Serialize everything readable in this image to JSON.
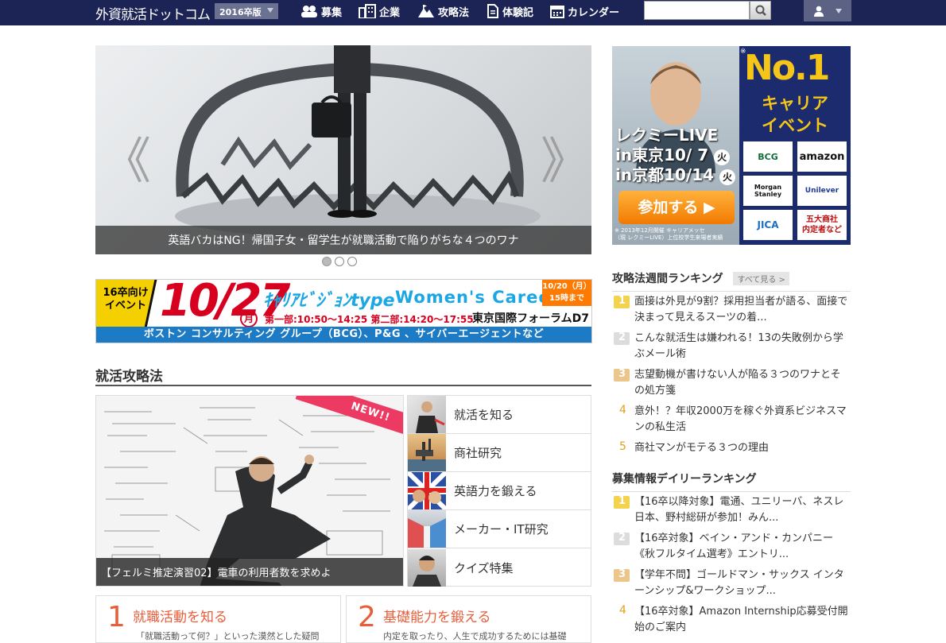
{
  "nav": {
    "logo": "外資就活ドットコム",
    "year": "2016卒版",
    "items": [
      "募集",
      "企業",
      "攻略法",
      "体験記",
      "カレンダー"
    ],
    "search_placeholder": ""
  },
  "hero": {
    "caption": "英語バカはNG！帰国子女・留学生が就職活動で陥りがちな４つのワナ",
    "prev": "《",
    "next": "》",
    "slides_total": 3,
    "slide_active": 1
  },
  "banner": {
    "tag": "16卒向け\nイベント",
    "date": "10/27",
    "weekday": "月",
    "career_vision": "ｷｬﾘｱﾋﾞｼﾞｮﾝtype",
    "womens": "Women's Career",
    "deadline": "10/20（月）\n15時まで",
    "times": "第一部:10:50〜14:25  第二部:14:20〜17:55",
    "venue": "東京国際フォーラムD7",
    "companies": "ボストン コンサルティング グループ（BCG）、P&G 、サイバーエージェントなど"
  },
  "section": {
    "title": "就活攻略法"
  },
  "feature": {
    "new_tag": "NEW!!",
    "caption": "【フェルミ推定演習02】電車の利用者数を求めよ"
  },
  "menu": {
    "items": [
      "就活を知る",
      "商社研究",
      "英語力を鍛える",
      "メーカー・IT研究",
      "クイズ特集"
    ]
  },
  "boxes": [
    {
      "num": "1",
      "title": "就職活動を知る",
      "desc": "「就職活動って何？」といった漠然とした疑問"
    },
    {
      "num": "2",
      "title": "基礎能力を鍛える",
      "desc": "内定を取ったり、人生で成功するためには基礎"
    }
  ],
  "ad": {
    "live": "レクミーLIVE",
    "tokyo": "in東京10/ 7",
    "kyoto": "in京都10/14",
    "weekday": "火",
    "join": "参加する ▶",
    "fine1": "※ 2013年12月開催 キャリアメッセ",
    "fine2": "（現 レクミーLIVE）上位校学生来場者実績",
    "asterisk": "※",
    "no1": "No.1",
    "career_event": "キャリア\nイベント",
    "logos": [
      "BCG",
      "amazon",
      "Morgan Stanley",
      "Unilever",
      "JICA",
      "五大商社\n内定者など"
    ]
  },
  "weekly": {
    "title": "攻略法週間ランキング",
    "see_all": "すべて見る >",
    "items": [
      {
        "rank": "1",
        "text": "面接は外見が9割？採用担当者が語る、面接で決まって見えるスーツの着..."
      },
      {
        "rank": "2",
        "text": "こんな就活生は嫌われる！13の失敗例から学ぶメール術"
      },
      {
        "rank": "3",
        "text": "志望動機が書けない人が陥る３つのワナとその処方箋"
      },
      {
        "rank": "4",
        "text": "意外！？年収2000万を稼ぐ外資系ビジネスマンの私生活"
      },
      {
        "rank": "5",
        "text": "商社マンがモテる３つの理由"
      }
    ]
  },
  "daily": {
    "title": "募集情報デイリーランキング",
    "items": [
      {
        "rank": "1",
        "text": "【16卒以降対象】電通、ユニリーバ、ネスレ日本、野村総研が参加！みん..."
      },
      {
        "rank": "2",
        "text": "【16卒対象】ベイン・アンド・カンパニー《秋フルタイム選考》エントリ..."
      },
      {
        "rank": "3",
        "text": "【学年不問】ゴールドマン・サックス インターンシップ&ワークショップ..."
      },
      {
        "rank": "4",
        "text": "【16卒対象】Amazon Internship応募受付開始のご案内"
      }
    ]
  }
}
